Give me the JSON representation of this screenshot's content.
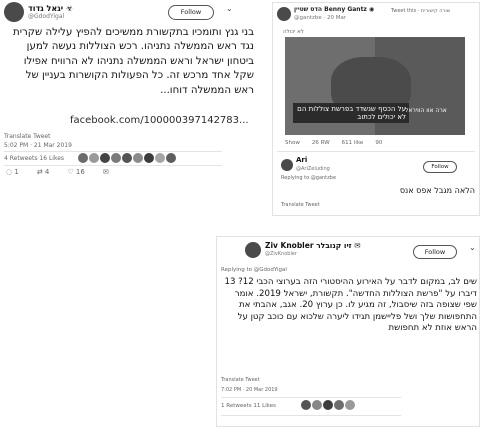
{
  "t1": {
    "name": "יגאל גדוד ☣",
    "handle": "@GdodYigal",
    "follow": "Follow",
    "caret": "⌄",
    "body": "בני גנץ ותומכיו בתקשורת ממשיכים להפיץ עלילה שקרית נגד ראש הממשלה נתניהו. רכש הצוללות נעשה למען ביטחון ישראל וראש הממשלה נתניהו לא הרוויח אפילו שקל אחד מרכש זה. כל הפעולות הקושרות בעניין של ראש הממשלה דוחו...",
    "link": "facebook.com/100000397142783...",
    "translate": "Translate Tweet",
    "time": "5:02 PM · 21 Mar 2019",
    "rt_label": "Retweets",
    "rt_count": "4",
    "like_label": "Likes",
    "like_count": "16",
    "replies": "1",
    "retweets": "4",
    "likes": "16"
  },
  "t2": {
    "name": "הדס שטיין Benny Gantz ◉",
    "handle": "@gantzbe · 20 Mar",
    "top_right": "Tweet this · שורה קישורית",
    "subhead": "לא יכולה",
    "image_text": "על הכסף שנשדד בפרשת צוללות הם לא יכולים לכתוב",
    "image_text2": "ארה אוו הוויראל",
    "actions": [
      "Show",
      "26 RW",
      "611 like",
      "90"
    ],
    "reply_name": "Ari",
    "reply_handle": "@AriZeluding",
    "reply_follow": "Follow",
    "reply_sub": "Replying to @gantzbe",
    "reply_body": "הלאה מגבל אפס אנס",
    "reply_footer": "Translate Tweet"
  },
  "t3": {
    "name": "Ziv Knobler זיו קנובלר ✉",
    "handle": "@ZivKnobler",
    "follow": "Follow",
    "caret": "⌄",
    "replying": "Replying to @GdodYigal",
    "body": "שים לב, במקום לדבר על האירוע ההיסטורי הזה בערוצי הכבי 12? 13 דיברו על \"פרשת הצוללות החדשה\". תקשורת, ישראל 2019. אומר שפי שצופה בזה שיסבול, זה מגיע לו. כן ערוץ 20. אגב, אהבתי את התחפושות שלך ושל פליישמן תגידו ליערה שלכוא עם כוכב קטן על הראש אוזת לא תחפושת",
    "translate": "Translate Tweet",
    "time": "7:02 PM · 20 Mar 2019",
    "rt_label": "Retweets",
    "rt_count": "1",
    "like_label": "Likes",
    "like_count": "11"
  },
  "colors": {
    "accent": "#1da1f2",
    "image_bg": "#5a5a5a"
  }
}
